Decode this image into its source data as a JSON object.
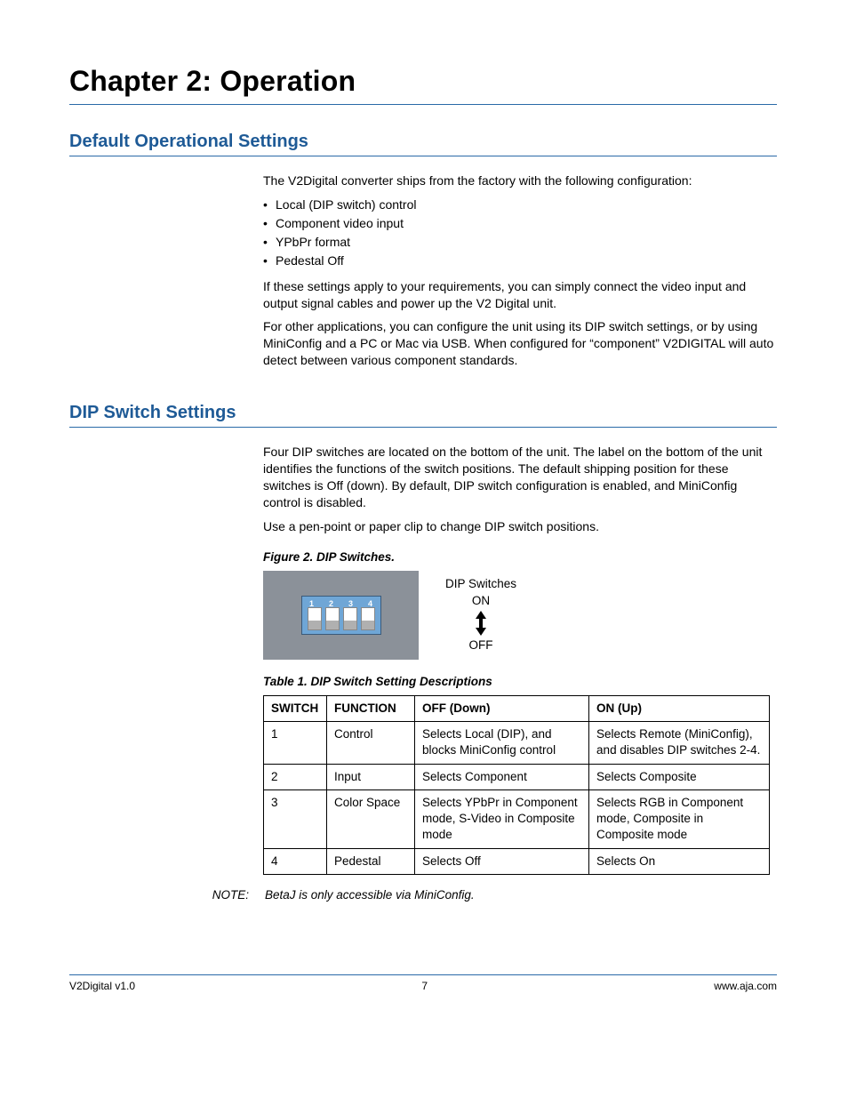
{
  "chapter_title": "Chapter 2: Operation",
  "sections": {
    "defaults": {
      "title": "Default Operational Settings",
      "intro": "The V2Digital converter ships from the factory with the following configuration:",
      "bullets": [
        "Local (DIP switch) control",
        "Component video input",
        "YPbPr format",
        "Pedestal Off"
      ],
      "para2": "If these settings apply to your requirements, you can simply connect the video input and output signal cables and power up the V2 Digital unit.",
      "para3": "For other applications, you can configure the unit using its DIP switch settings, or by using MiniConfig and a PC or Mac via USB. When configured for “component” V2DIGITAL will auto detect between various component standards."
    },
    "dip": {
      "title": "DIP Switch Settings",
      "para1": "Four DIP switches are located on the bottom of the unit. The label on the bottom of the unit identifies the functions of the switch positions. The default shipping position for these switches is Off (down). By default, DIP switch configuration is enabled, and MiniConfig control is disabled.",
      "para2": "Use a pen-point or paper clip to change DIP switch positions.",
      "figure_caption": "Figure 2. DIP Switches.",
      "legend_title": "DIP Switches",
      "legend_on": "ON",
      "legend_off": "OFF",
      "table_caption": "Table 1. DIP Switch Setting Descriptions",
      "table": {
        "headers": [
          "SWITCH",
          "FUNCTION",
          "OFF (Down)",
          "ON (Up)"
        ],
        "rows": [
          [
            "1",
            "Control",
            "Selects Local (DIP), and blocks MiniConfig control",
            "Selects Remote (MiniConfig), and disables DIP switches 2-4."
          ],
          [
            "2",
            "Input",
            "Selects Component",
            "Selects Composite"
          ],
          [
            "3",
            "Color Space",
            "Selects YPbPr in Component mode, S-Video in Composite mode",
            "Selects RGB in Component mode, Composite in Composite mode"
          ],
          [
            "4",
            "Pedestal",
            "Selects Off",
            "Selects On"
          ]
        ]
      },
      "note_label": "NOTE:",
      "note_text": "BetaJ is only accessible via MiniConfig."
    }
  },
  "footer": {
    "left": "V2Digital v1.0",
    "center": "7",
    "right": "www.aja.com"
  }
}
